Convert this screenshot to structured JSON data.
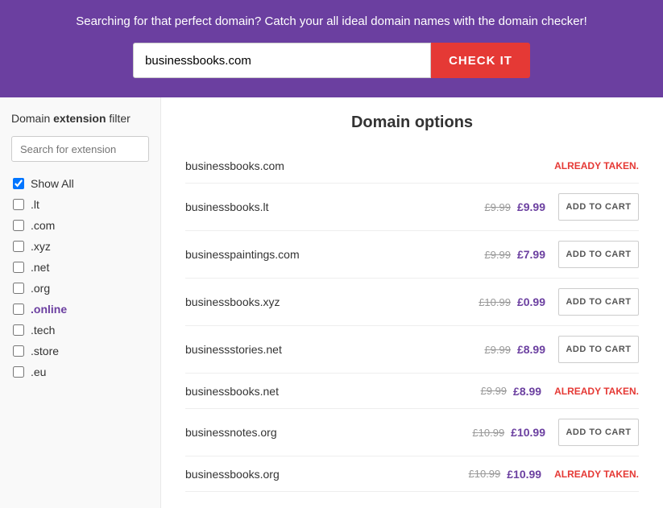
{
  "header": {
    "tagline": "Searching for that perfect domain? Catch your all ideal domain names with the domain checker!",
    "input_value": "businessbooks.com",
    "input_placeholder": "businessbooks.com",
    "check_button_label": "CHECK IT"
  },
  "sidebar": {
    "title_normal": "Domain ",
    "title_bold": "extension",
    "title_suffix": " filter",
    "search_placeholder": "Search for extension",
    "extensions": [
      {
        "label": "Show All",
        "checked": true
      },
      {
        "label": ".lt",
        "checked": false
      },
      {
        "label": ".com",
        "checked": false
      },
      {
        "label": ".xyz",
        "checked": false
      },
      {
        "label": ".net",
        "checked": false
      },
      {
        "label": ".org",
        "checked": false
      },
      {
        "label": ".online",
        "checked": false,
        "highlight": true
      },
      {
        "label": ".tech",
        "checked": false
      },
      {
        "label": ".store",
        "checked": false
      },
      {
        "label": ".eu",
        "checked": false
      }
    ]
  },
  "main": {
    "section_title": "Domain options",
    "rows": [
      {
        "domain": "businessbooks.com",
        "old_price": "",
        "new_price": "",
        "status": "taken",
        "status_label": "ALREADY TAKEN."
      },
      {
        "domain": "businessbooks.lt",
        "old_price": "£9.99",
        "new_price": "£9.99",
        "status": "available",
        "btn_label": "ADD TO CART"
      },
      {
        "domain": "businesspaintings.com",
        "old_price": "£9.99",
        "new_price": "£7.99",
        "status": "available",
        "btn_label": "ADD TO CART"
      },
      {
        "domain": "businessbooks.xyz",
        "old_price": "£10.99",
        "new_price": "£0.99",
        "status": "available",
        "btn_label": "ADD TO CART"
      },
      {
        "domain": "businessstories.net",
        "old_price": "£9.99",
        "new_price": "£8.99",
        "status": "available",
        "btn_label": "ADD TO CART"
      },
      {
        "domain": "businessbooks.net",
        "old_price": "£9.99",
        "new_price": "£8.99",
        "status": "taken",
        "status_label": "ALREADY TAKEN."
      },
      {
        "domain": "businessnotes.org",
        "old_price": "£10.99",
        "new_price": "£10.99",
        "status": "available",
        "btn_label": "ADD TO CART"
      },
      {
        "domain": "businessbooks.org",
        "old_price": "£10.99",
        "new_price": "£10.99",
        "status": "taken",
        "status_label": "ALREADY TAKEN."
      }
    ]
  }
}
